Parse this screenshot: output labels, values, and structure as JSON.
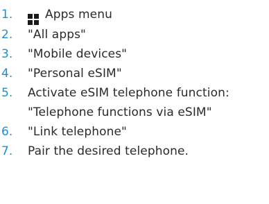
{
  "steps": [
    {
      "number": "1.",
      "icon": "apps-grid-icon",
      "text": "Apps menu"
    },
    {
      "number": "2.",
      "text": "\"All apps\""
    },
    {
      "number": "3.",
      "text": "\"Mobile devices\""
    },
    {
      "number": "4.",
      "text": "\"Personal eSIM\""
    },
    {
      "number": "5.",
      "text": "Activate eSIM telephone function:",
      "text2": "\"Telephone functions via eSIM\""
    },
    {
      "number": "6.",
      "text": "\"Link telephone\""
    },
    {
      "number": "7.",
      "text": "Pair the desired telephone."
    }
  ],
  "colors": {
    "number": "#1b8fd2",
    "text": "#2a2a2a",
    "icon": "#1a1a1a"
  }
}
